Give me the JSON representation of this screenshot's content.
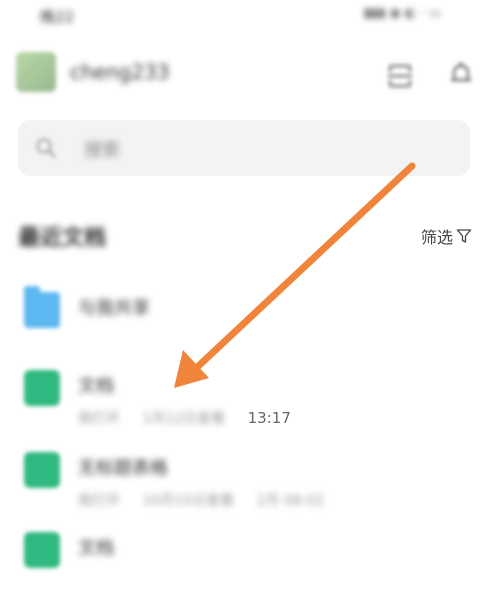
{
  "status_bar": {
    "time": "晚22",
    "icons_text": "▮▮▮ ◉ ◐ · ▭"
  },
  "header": {
    "username": "cheng233",
    "scan_icon": "scan-icon",
    "bell_icon": "bell-icon"
  },
  "search": {
    "placeholder": "搜索"
  },
  "section": {
    "title": "最近文档",
    "filter_label": "筛选"
  },
  "items": [
    {
      "type": "folder",
      "name": "与我共享",
      "meta": []
    },
    {
      "type": "doc",
      "name": "文档",
      "meta": [
        "我打开",
        "1月12日查看",
        "13:17"
      ]
    },
    {
      "type": "doc",
      "name": "无标题表格",
      "meta": [
        "我打开",
        "10月15日查看",
        "2月 08:02"
      ]
    },
    {
      "type": "doc",
      "name": "文档",
      "meta": []
    }
  ],
  "colors": {
    "arrow": "#f0843a",
    "folder": "#5db7f0",
    "doc": "#2fb87f"
  }
}
